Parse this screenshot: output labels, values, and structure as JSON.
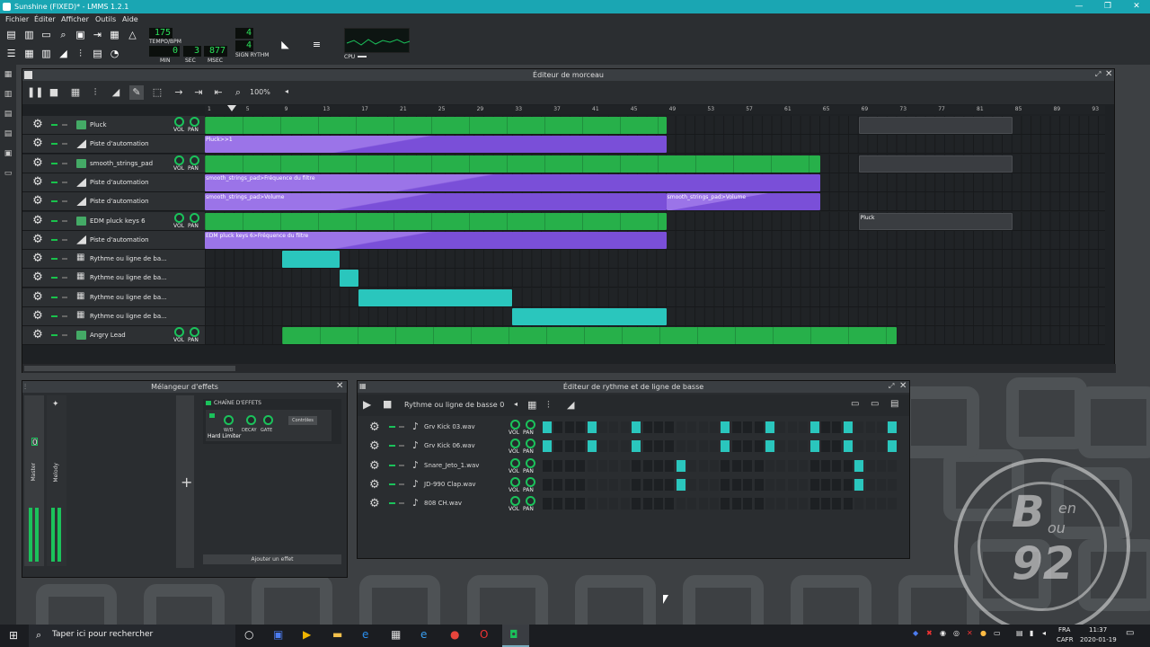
{
  "window": {
    "title": "Sunshine (FIXED)* - LMMS 1.2.1",
    "minimize": "—",
    "maximize": "❐",
    "close": "✕"
  },
  "menu": [
    "Fichier",
    "Éditer",
    "Afficher",
    "Outils",
    "Aide"
  ],
  "toolbar": {
    "tempo": "175",
    "tempo_label": "TEMPO/BPM",
    "min": "0",
    "min_label": "MIN",
    "sec": "3",
    "sec_label": "SEC",
    "msec": "877",
    "msec_label": "MSEC",
    "sig_num": "4",
    "sig_den": "4",
    "sig_label": "SIGN RYTHM",
    "cpu_label": "CPU"
  },
  "song_editor": {
    "title": "Éditeur de morceau",
    "zoom": "100%",
    "ruler": [
      "1",
      "5",
      "9",
      "13",
      "17",
      "21",
      "25",
      "29",
      "33",
      "37",
      "41",
      "45",
      "49",
      "53",
      "57",
      "61",
      "65",
      "69",
      "73",
      "77",
      "81",
      "85",
      "89",
      "93"
    ],
    "tracks": [
      {
        "name": "Pluck",
        "type": "instrument"
      },
      {
        "name": "Piste d'automation",
        "type": "automation"
      },
      {
        "name": "smooth_strings_pad",
        "type": "instrument"
      },
      {
        "name": "Piste d'automation",
        "type": "automation"
      },
      {
        "name": "Piste d'automation",
        "type": "automation"
      },
      {
        "name": "EDM pluck keys 6",
        "type": "instrument"
      },
      {
        "name": "Piste d'automation",
        "type": "automation"
      },
      {
        "name": "Rythme ou ligne de ba...",
        "type": "beat"
      },
      {
        "name": "Rythme ou ligne de ba...",
        "type": "beat"
      },
      {
        "name": "Rythme ou ligne de ba...",
        "type": "beat"
      },
      {
        "name": "Rythme ou ligne de ba...",
        "type": "beat"
      },
      {
        "name": "Angry Lead",
        "type": "instrument"
      }
    ],
    "clip_labels": {
      "a1": "Pluck>>1",
      "a3": "smooth_strings_pad>Fréquence du filtre",
      "a4": "smooth_strings_pad>Volume",
      "a4b": "smooth_strings_pad>Volume",
      "a6": "EDM pluck keys 6>Fréquence du filtre",
      "pluck": "Pluck"
    },
    "vol": "VOL",
    "pan": "PAN"
  },
  "fx_mixer": {
    "title": "Mélangeur d'effets",
    "chain_label": "CHAÎNE D'EFFETS",
    "wd": "W/D",
    "decay": "DECAY",
    "gate": "GATE",
    "controls": "Contrôles",
    "effect": "Hard Limiter",
    "add_effect": "Ajouter un effet",
    "channels": [
      "Master",
      "Melody"
    ],
    "channel_nums": [
      "0",
      "1"
    ],
    "add": "+"
  },
  "beat_editor": {
    "title": "Éditeur de rythme et de ligne de basse",
    "pattern": "Rythme ou ligne de basse 0",
    "rows": [
      {
        "name": "Grv Kick 03.wav",
        "steps": [
          1,
          0,
          0,
          0,
          1,
          0,
          0,
          0,
          1,
          0,
          0,
          0,
          0,
          0,
          0,
          0,
          1,
          0,
          0,
          0,
          1,
          0,
          0,
          0,
          1,
          0,
          0,
          1,
          0,
          0,
          0,
          1
        ]
      },
      {
        "name": "Grv Kick 06.wav",
        "steps": [
          1,
          0,
          0,
          0,
          1,
          0,
          0,
          0,
          1,
          0,
          0,
          0,
          0,
          0,
          0,
          0,
          1,
          0,
          0,
          0,
          1,
          0,
          0,
          0,
          1,
          0,
          0,
          1,
          0,
          0,
          0,
          1
        ]
      },
      {
        "name": "Snare_Jeto_1.wav",
        "steps": [
          0,
          0,
          0,
          0,
          0,
          0,
          0,
          0,
          0,
          0,
          0,
          0,
          1,
          0,
          0,
          0,
          0,
          0,
          0,
          0,
          0,
          0,
          0,
          0,
          0,
          0,
          0,
          0,
          1,
          0,
          0,
          0
        ]
      },
      {
        "name": "JD-990 Clap.wav",
        "steps": [
          0,
          0,
          0,
          0,
          0,
          0,
          0,
          0,
          0,
          0,
          0,
          0,
          1,
          0,
          0,
          0,
          0,
          0,
          0,
          0,
          0,
          0,
          0,
          0,
          0,
          0,
          0,
          0,
          1,
          0,
          0,
          0
        ]
      },
      {
        "name": "808 CH.wav",
        "steps": [
          0,
          0,
          0,
          0,
          0,
          0,
          0,
          0,
          0,
          0,
          0,
          0,
          0,
          0,
          0,
          0,
          0,
          0,
          0,
          0,
          0,
          0,
          0,
          0,
          0,
          0,
          0,
          0,
          0,
          0,
          0,
          0
        ]
      }
    ]
  },
  "watermark": {
    "b": "B",
    "en": "en",
    "ou": "ou",
    "num": "92"
  },
  "taskbar": {
    "search": "Taper ici pour rechercher",
    "lang": "FRA",
    "locale": "CAFR",
    "time": "11:37",
    "date": "2020-01-19"
  }
}
